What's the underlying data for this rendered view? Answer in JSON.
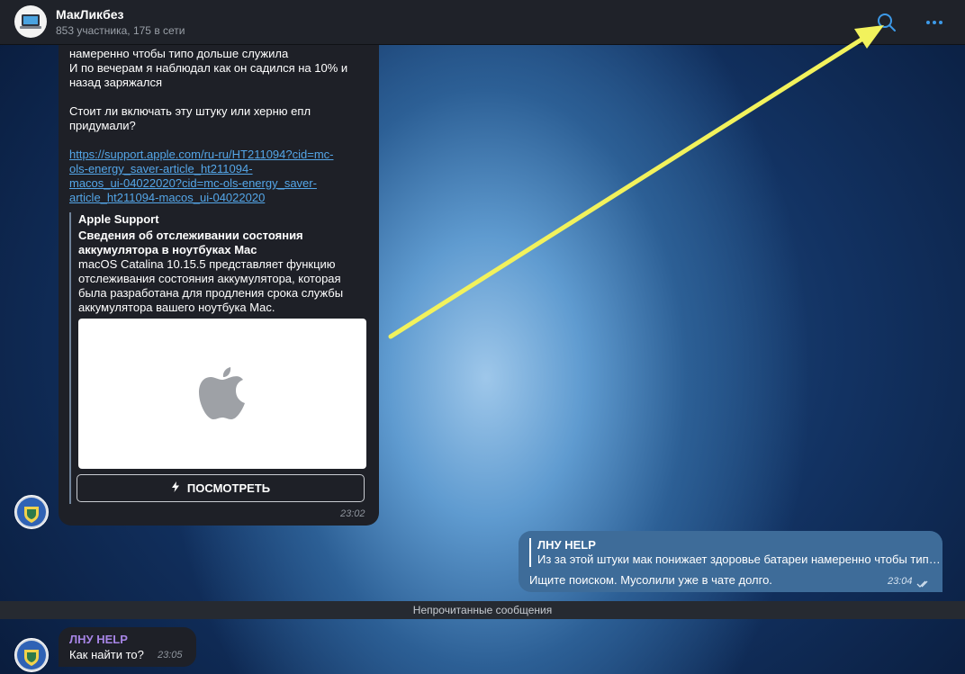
{
  "header": {
    "title": "МакЛикбез",
    "subtitle": "853 участника, 175 в сети",
    "search_icon": "search-icon",
    "more_icon": "more-dots-icon"
  },
  "message1": {
    "lines": [
      "намеренно чтобы типо дольше служила",
      "И по вечерам я наблюдал как он садился на 10% и",
      "назад заряжался",
      "",
      "Стоит ли включать эту штуку или херню епл",
      "придумали?"
    ],
    "link": {
      "line1": "https://support.apple.com/ru-ru/HT211094?cid=mc-",
      "line2": "ols-energy_saver-article_ht211094-",
      "line3": "macos_ui-04022020?cid=mc-ols-energy_saver-",
      "line4": "article_ht211094-macos_ui-04022020"
    },
    "preview": {
      "site": "Apple Support",
      "title": "Сведения об отслеживании состояния аккумулятора в ноутбуках Mac",
      "description": "macOS Catalina 10.15.5 представляет функцию отслеживания состояния аккумулятора, которая была разработана для продления срока службы аккумулятора вашего ноутбука Mac.",
      "image_icon": "apple-logo-icon"
    },
    "button_label": "ПОСМОТРЕТЬ",
    "button_icon": "lightning-icon",
    "time": "23:02"
  },
  "message2": {
    "reply_name": "ЛНУ HELP",
    "reply_text": "Из за этой штуки мак понижает здоровье батареи намеренно чтобы типо дольше служила",
    "text": "Ищите поиском. Мусолили уже в чате долго.",
    "time": "23:04",
    "status_icon": "double-check-icon"
  },
  "unread_separator": "Непрочитанные сообщения",
  "message3": {
    "sender": "ЛНУ HELP",
    "text": "Как найти то?",
    "time": "23:05"
  },
  "colors": {
    "accent": "#3d9ae8",
    "arrow": "#f2f25c",
    "link": "#54a6e8",
    "outgoing_bubble": "#3e6c99",
    "sender_name": "#a785e6"
  }
}
